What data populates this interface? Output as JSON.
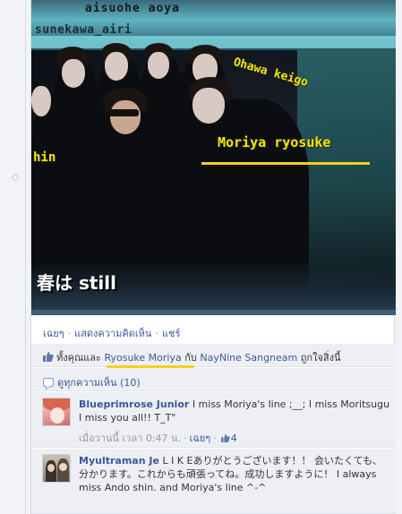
{
  "photo": {
    "overlay_top": "aisuohe aoya",
    "overlay_left_name": "sunekawa_airi",
    "overlay_ohawa": "Ohawa keigo",
    "overlay_moriya": "Moriya ryosuke",
    "overlay_shin": "hin",
    "overlay_still": "春は still"
  },
  "actions": {
    "like": "เฉยๆ",
    "comment": "แสดงความคิดเห็น",
    "share": "แชร์"
  },
  "likes": {
    "prefix": "ทั้งคุณและ",
    "person1": "Ryosuke Moriya",
    "conjunction": "กับ",
    "person2": "NayNine Sangneam",
    "suffix": "ถูกใจสิ่งนี้"
  },
  "comments_link": "ดูทุกความเห็น (10)",
  "comments": [
    {
      "author": "Blueprimrose Junior",
      "text": "I miss Moriya's line ;__; I miss Moritsugu I miss you all!! T_T\"",
      "time": "เมื่อวานนี้ เวลา 0:47 น.",
      "like_label": "เฉยๆ",
      "like_count": "4"
    },
    {
      "author": "Myultraman Je",
      "text": "L I K Eありがとうございます！！ 会いたくても、分かります。これからも頑張ってね。成功しますように！  I always miss Ando shin. and Moriya's line ^-^"
    }
  ],
  "colors": {
    "link": "#3b5998",
    "highlight_underline": "#f4d21d",
    "overlay_text": "#f2e600",
    "comment_bg": "#edeff4"
  }
}
